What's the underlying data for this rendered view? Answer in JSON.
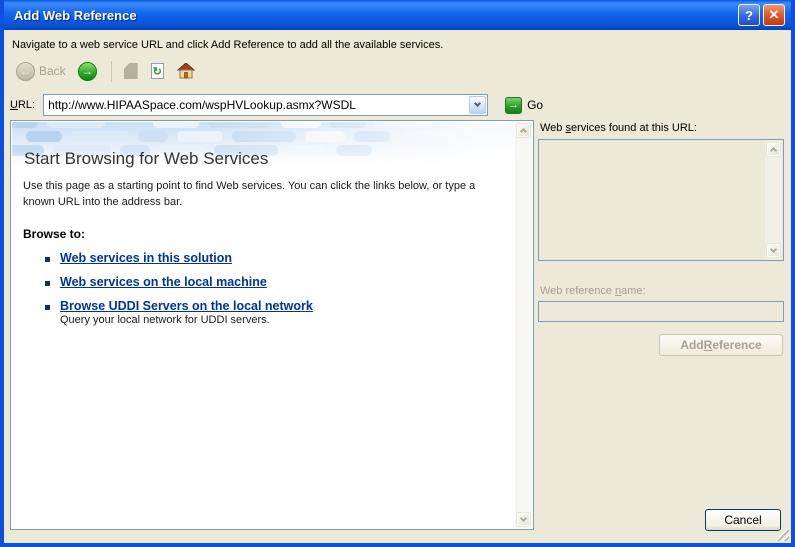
{
  "window": {
    "title": "Add Web Reference",
    "description": "Navigate to a web service URL and click Add Reference to add all the available services."
  },
  "icons": {
    "help": "?",
    "close": "✕",
    "back_arrow": "←",
    "forward_arrow": "→",
    "refresh": "↻",
    "go_arrow": "→",
    "dropdown": "chevron-down",
    "stop": "document",
    "home": "house"
  },
  "toolbar": {
    "back_label": "Back"
  },
  "url_bar": {
    "label": {
      "pre": "",
      "key": "U",
      "post": "RL:"
    },
    "value": "http://www.HIPAASpace.com/wspHVLookup.asmx?WSDL",
    "go_label": "Go"
  },
  "browser": {
    "heading": "Start Browsing for Web Services",
    "intro": "Use this page as a starting point to find Web services. You can click the links below, or type a known URL into the address bar.",
    "browse_to_label": "Browse to:",
    "links": [
      {
        "label": "Web services in this solution",
        "note": ""
      },
      {
        "label": "Web services on the local machine",
        "note": ""
      },
      {
        "label": "Browse UDDI Servers on the local network",
        "note": "Query your local network for UDDI servers."
      }
    ]
  },
  "results": {
    "found_label": {
      "pre": "Web ",
      "key": "s",
      "post": "ervices found at this URL:"
    },
    "name_label": {
      "pre": "Web reference ",
      "key": "n",
      "post": "ame:"
    },
    "name_value": "",
    "add_button": {
      "pre": "Add ",
      "key": "R",
      "post": "eference"
    }
  },
  "footer": {
    "cancel_label": "Cancel"
  },
  "colors": {
    "titlebar_blue": "#0c50dd",
    "dialog_bg": "#ece9d8",
    "panel_border": "#7f9db9",
    "link_navy": "#003399",
    "go_green": "#2a9a2a",
    "disabled_text": "#a6a191"
  }
}
